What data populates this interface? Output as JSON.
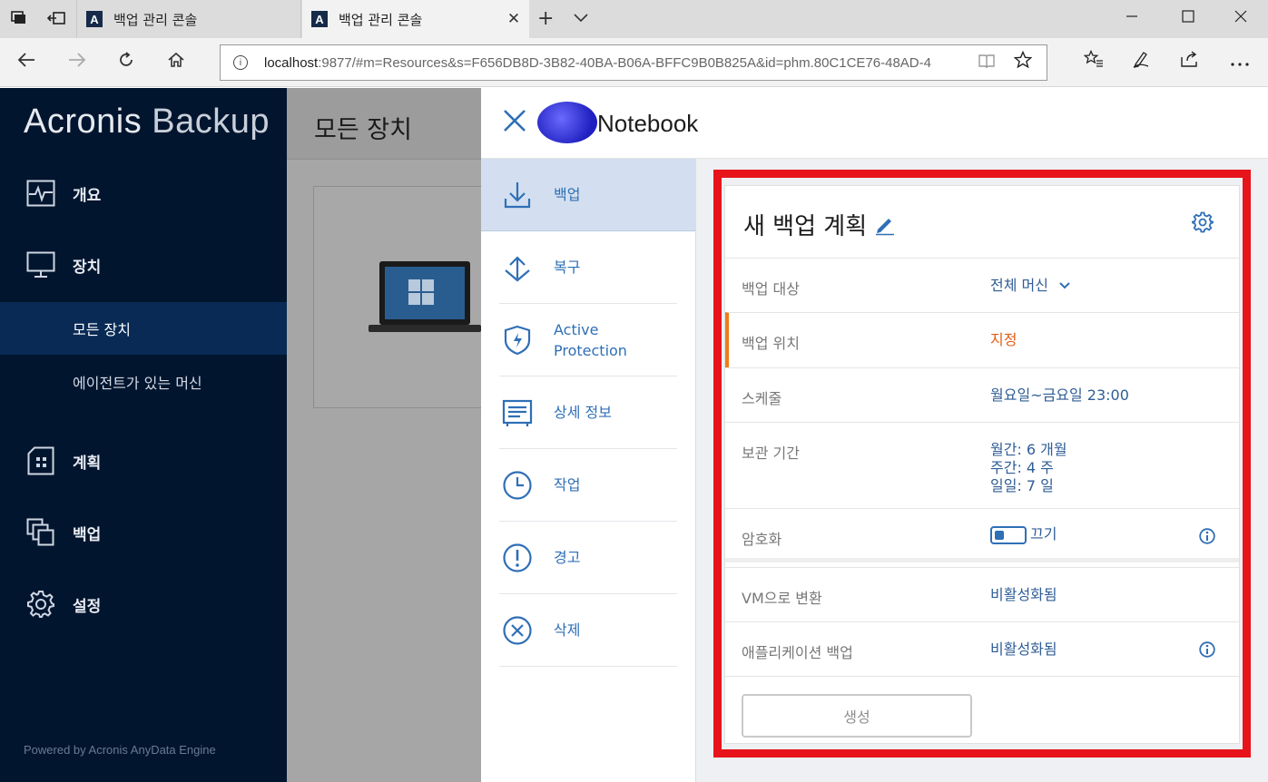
{
  "browser": {
    "tabs": [
      {
        "title": "백업 관리 콘솔",
        "favicon": "A"
      },
      {
        "title": "백업 관리 콘솔",
        "favicon": "A"
      }
    ],
    "close_glyph": "✕",
    "new_tab_glyph": "+",
    "address_host": "localhost",
    "address_rest": ":9877/#m=Resources&s=F656DB8D-3B82-40BA-B06A-BFFC9B0B825A&id=phm.80C1CE76-48AD-4"
  },
  "sidebar": {
    "brand_bold": "Acronis",
    "brand_light": " Backup",
    "items": [
      {
        "label": "개요",
        "icon": "overview-icon"
      },
      {
        "label": "장치",
        "icon": "monitor-icon"
      },
      {
        "label": "계획",
        "icon": "plan-icon"
      },
      {
        "label": "백업",
        "icon": "backup-copies-icon"
      },
      {
        "label": "설정",
        "icon": "gear-icon"
      }
    ],
    "sub_items": [
      "모든 장치",
      "에이전트가 있는 머신"
    ],
    "powered_by": "Powered by Acronis AnyData Engine"
  },
  "main": {
    "title": "모든 장치"
  },
  "panel": {
    "title": "Notebook",
    "menu": [
      "백업",
      "복구",
      "Active\nProtection",
      "상세 정보",
      "작업",
      "경고",
      "삭제"
    ],
    "plan": {
      "title": "새 백업 계획",
      "rows": [
        {
          "label": "백업 대상",
          "value": "전체 머신"
        },
        {
          "label": "백업 위치",
          "value": "지정"
        },
        {
          "label": "스케줄",
          "value": "월요일~금요일 23:00"
        },
        {
          "label": "보관 기간",
          "value_lines": [
            "월간: 6 개월",
            "주간: 4 주",
            "일일: 7 일"
          ]
        },
        {
          "label": "암호화",
          "value": "끄기"
        },
        {
          "label": "VM으로 변환",
          "value": "비활성화됨"
        },
        {
          "label": "애플리케이션 백업",
          "value": "비활성화됨"
        }
      ],
      "create_button": "생성"
    }
  },
  "colors": {
    "accent": "#2f6fb6",
    "warning": "#e65d12",
    "highlight_frame": "#e8141c",
    "sidebar_bg": "#02152f"
  }
}
